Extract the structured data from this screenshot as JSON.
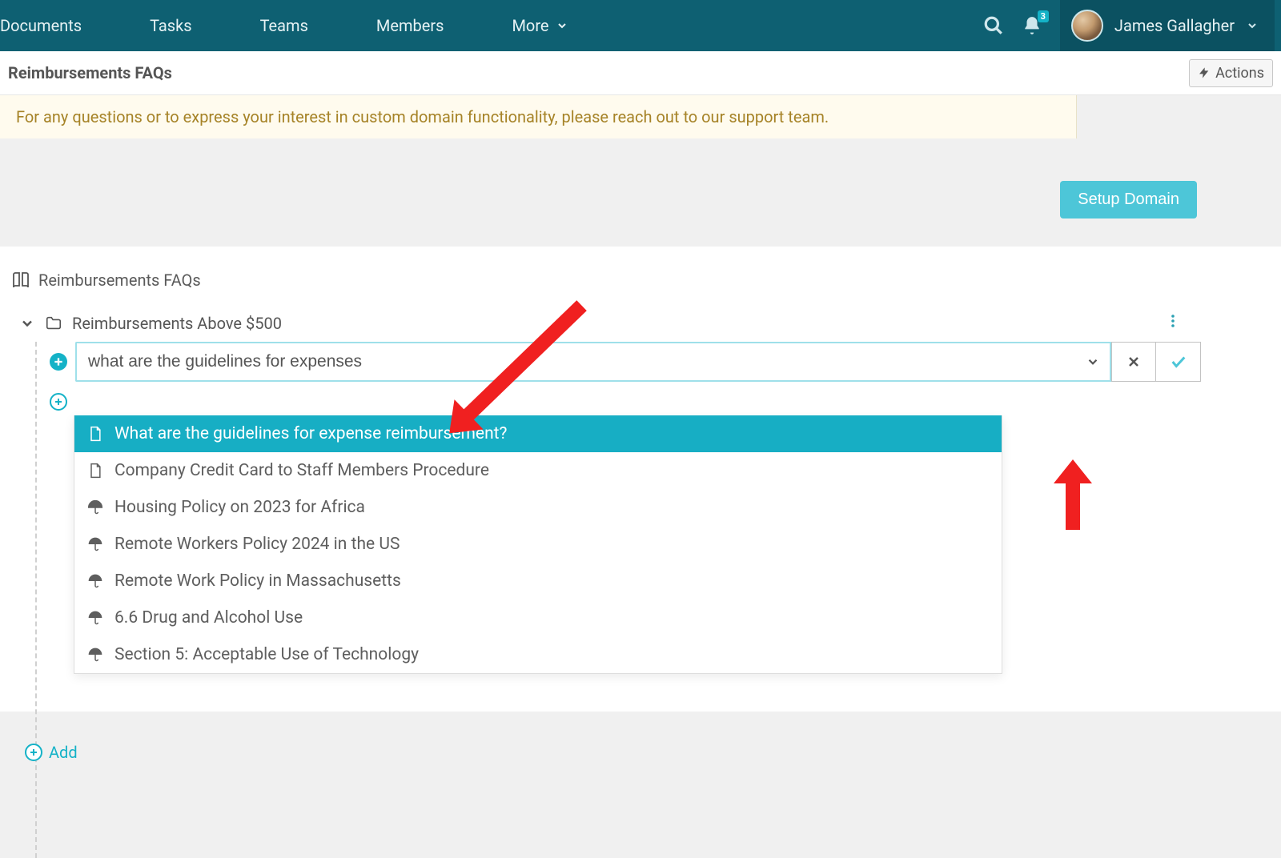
{
  "nav": {
    "items": [
      "Documents",
      "Tasks",
      "Teams",
      "Members",
      "More"
    ],
    "notification_count": "3",
    "user_name": "James Gallagher"
  },
  "subheader": {
    "title": "Reimbursements FAQs",
    "actions_label": "Actions"
  },
  "banner": {
    "text": "For any questions or to express your interest in custom domain functionality, please reach out to our support team.",
    "setup_label": "Setup Domain"
  },
  "tree": {
    "root_label": "Reimbursements FAQs",
    "folder_label": "Reimbursements Above $500",
    "search_value": "what are the guidelines for expenses",
    "add_label": "Add",
    "suggestions": [
      {
        "label": "What are the guidelines for expense reimbursement?",
        "icon": "page",
        "selected": true
      },
      {
        "label": "Company Credit Card to Staff Members Procedure",
        "icon": "page",
        "selected": false
      },
      {
        "label": "Housing Policy on 2023 for Africa",
        "icon": "umbrella",
        "selected": false
      },
      {
        "label": "Remote Workers Policy 2024 in the US",
        "icon": "umbrella",
        "selected": false
      },
      {
        "label": "Remote Work Policy in Massachusetts",
        "icon": "umbrella",
        "selected": false
      },
      {
        "label": "6.6 Drug and Alcohol Use",
        "icon": "umbrella",
        "selected": false
      },
      {
        "label": "Section 5: Acceptable Use of Technology",
        "icon": "umbrella",
        "selected": false
      }
    ]
  }
}
